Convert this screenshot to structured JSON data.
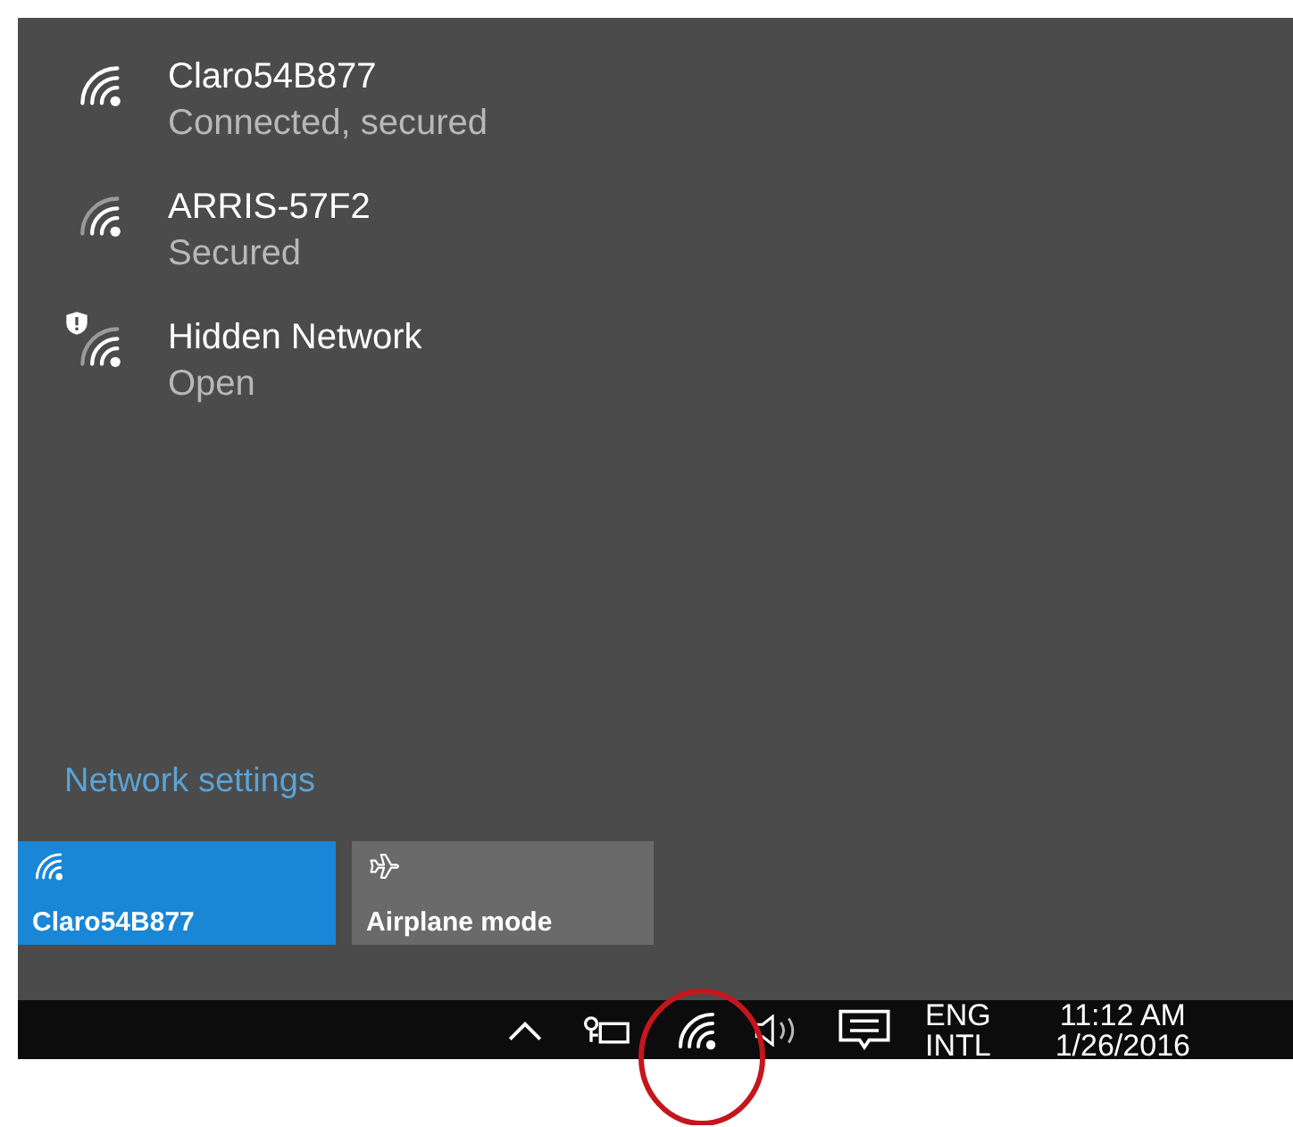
{
  "networks": [
    {
      "name": "Claro54B877",
      "status": "Connected, secured",
      "connected": true,
      "warning": false
    },
    {
      "name": "ARRIS-57F2",
      "status": "Secured",
      "connected": false,
      "warning": false
    },
    {
      "name": "Hidden Network",
      "status": "Open",
      "connected": false,
      "warning": true
    }
  ],
  "settings_link": "Network settings",
  "tiles": [
    {
      "kind": "wifi",
      "label": "Claro54B877",
      "on": true
    },
    {
      "kind": "airplane",
      "label": "Airplane mode",
      "on": false
    }
  ],
  "taskbar": {
    "language": "ENG",
    "layout": "INTL",
    "time": "11:12 AM",
    "date": "1/26/2016"
  }
}
